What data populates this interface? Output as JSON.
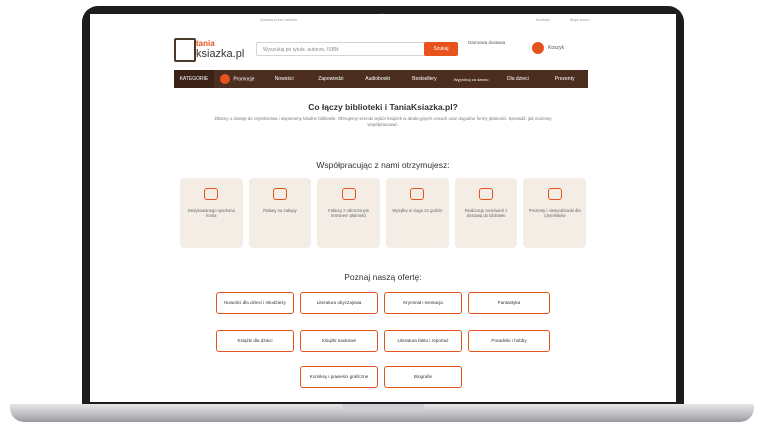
{
  "header": {
    "top_left": "Zamów przez telefon",
    "top_right_1": "Kontakt",
    "top_right_2": "Moje konto",
    "logo_line1": "tania",
    "logo_line2": "ksiazka.pl",
    "search_placeholder": "Wyszukaj po tytule, autorze, ISBN",
    "search_button": "Szukaj",
    "delivery": "Darmowa dostawa",
    "cart_label": "Koszyk"
  },
  "nav": {
    "items": [
      "KATEGORIE",
      "Promocje",
      "Nowości",
      "Zapowiedzi",
      "Audiobooki",
      "Bestsellery",
      "Wypróbuj za darmo",
      "Dla dzieci",
      "Prezenty"
    ]
  },
  "main": {
    "title": "Co łączy biblioteki i TaniaKsiazka.pl?",
    "intro": "Dbamy o dostęp do czytelnictwa i wspieramy lokalne biblioteki. Oferujemy szeroki wybór książek w atrakcyjnych cenach oraz dogodne formy płatności. Sprawdź, jak możemy współpracować.",
    "partners_title": "Współpracując z nami otrzymujesz:",
    "benefits": [
      "Dedykowanego opiekuna konta",
      "Rabaty na zakupy",
      "Faktury z odroczonym terminem płatności",
      "Wysyłkę w ciągu 24 godzin",
      "Realizację zamówień z dostawą do biblioteki",
      "Prezenty i niespodzianki dla czytelników"
    ],
    "offer_title": "Poznaj naszą ofertę:",
    "offers_row1": [
      "Nowości dla dzieci i młodzieży",
      "Literatura obyczajowa",
      "Kryminał i sensacja",
      "Fantastyka"
    ],
    "offers_row2": [
      "Książki dla dzieci",
      "Książki naukowe",
      "Literatura faktu i reportaż",
      "Poradniki i hobby"
    ],
    "offers_row3": [
      "Komiksy i powieści graficzne",
      "Biografie"
    ]
  },
  "colors": {
    "accent": "#e8531d",
    "nav_bg": "#4b2e20",
    "tile_bg": "#f3ede5"
  }
}
